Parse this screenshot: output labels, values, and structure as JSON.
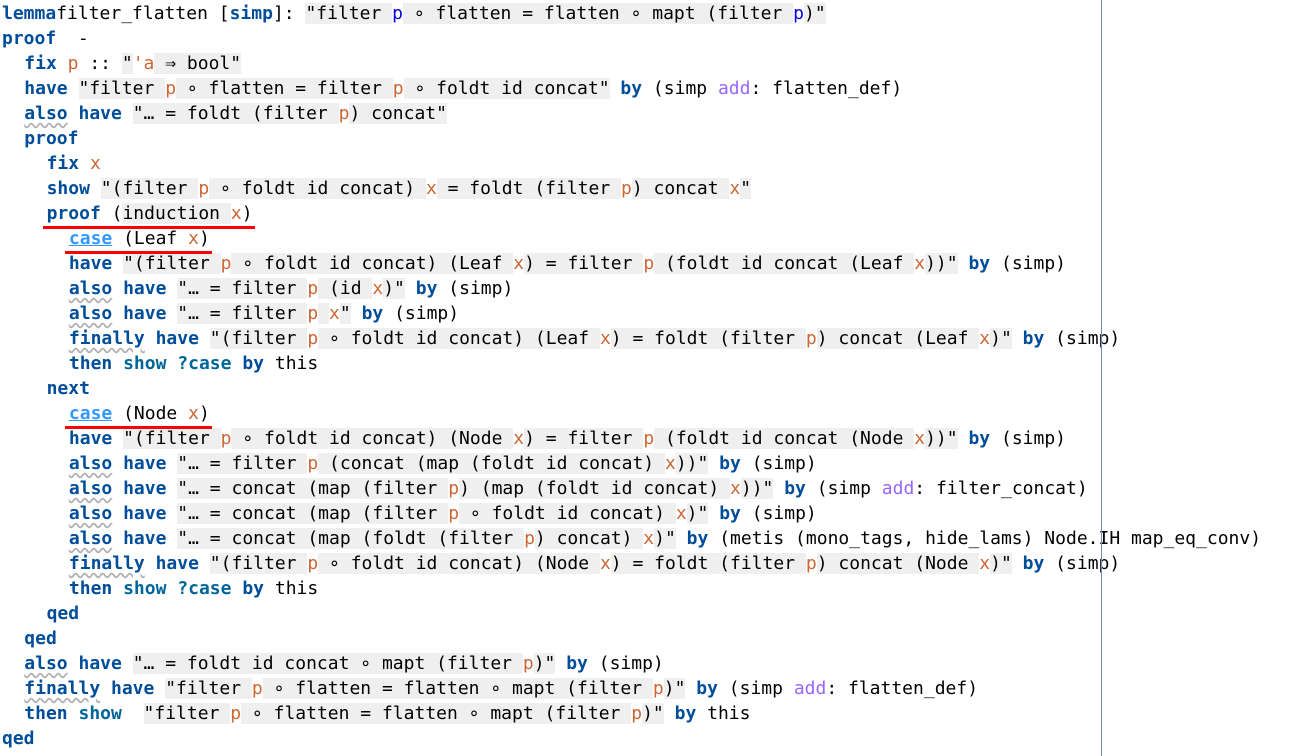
{
  "editor": {
    "lines": [
      {
        "indent": 0,
        "tokens": [
          [
            "kw",
            "lemma"
          ],
          [
            "",
            "filter_flatten ["
          ],
          [
            "kw",
            "simp"
          ],
          [
            "",
            "]: "
          ],
          [
            "str",
            "\"filter "
          ],
          [
            "fb",
            "p"
          ],
          [
            "str",
            " ∘ flatten = flatten ∘ mapt (filter "
          ],
          [
            "fb",
            "p"
          ],
          [
            "str",
            ")\""
          ]
        ]
      },
      {
        "indent": 0,
        "tokens": [
          [
            "kw",
            "proof"
          ],
          [
            "",
            "  -"
          ]
        ]
      },
      {
        "indent": 1,
        "tokens": [
          [
            "kw",
            "fix"
          ],
          [
            "",
            " "
          ],
          [
            "fv",
            "p"
          ],
          [
            "",
            " :: "
          ],
          [
            "str",
            "\""
          ],
          [
            "tv",
            "'a"
          ],
          [
            "str",
            " ⇒ bool\""
          ]
        ]
      },
      {
        "indent": 1,
        "tokens": [
          [
            "kw",
            "have"
          ],
          [
            "",
            " "
          ],
          [
            "str",
            "\"filter "
          ],
          [
            "fv",
            "p"
          ],
          [
            "str",
            " ∘ flatten = filter "
          ],
          [
            "fv",
            "p"
          ],
          [
            "str",
            " ∘ foldt id concat\""
          ],
          [
            "",
            " "
          ],
          [
            "kw",
            "by"
          ],
          [
            "",
            " ("
          ],
          [
            "",
            "simp "
          ],
          [
            "add",
            "add"
          ],
          [
            "",
            ": flatten_def)"
          ]
        ]
      },
      {
        "indent": 1,
        "tokens": [
          [
            "kw sq",
            "also"
          ],
          [
            "",
            " "
          ],
          [
            "kw",
            "have"
          ],
          [
            "",
            " "
          ],
          [
            "str",
            "\"… = foldt (filter "
          ],
          [
            "fv",
            "p"
          ],
          [
            "str",
            ") concat\""
          ]
        ]
      },
      {
        "indent": 1,
        "tokens": [
          [
            "kw",
            "proof"
          ]
        ]
      },
      {
        "indent": 2,
        "tokens": [
          [
            "kw",
            "fix"
          ],
          [
            "",
            " "
          ],
          [
            "fv",
            "x"
          ]
        ]
      },
      {
        "indent": 2,
        "tokens": [
          [
            "kw",
            "show"
          ],
          [
            "",
            " "
          ],
          [
            "str",
            "\"(filter "
          ],
          [
            "fv",
            "p"
          ],
          [
            "str",
            " ∘ foldt id concat) "
          ],
          [
            "fv",
            "x"
          ],
          [
            "str",
            " = foldt (filter "
          ],
          [
            "fv",
            "p"
          ],
          [
            "str",
            ") concat "
          ],
          [
            "fv",
            "x"
          ],
          [
            "str",
            "\""
          ]
        ]
      },
      {
        "indent": 2,
        "tokens": [
          [
            "kw",
            "proof"
          ],
          [
            "",
            " ("
          ],
          [
            "str",
            "induction "
          ],
          [
            "fv",
            "x"
          ],
          [
            "",
            ")"
          ]
        ]
      },
      {
        "indent": 3,
        "tokens": [
          [
            "case",
            "case"
          ],
          [
            "",
            " (Leaf "
          ],
          [
            "fv",
            "x"
          ],
          [
            "",
            ")"
          ]
        ]
      },
      {
        "indent": 3,
        "tokens": [
          [
            "kw",
            "have"
          ],
          [
            "",
            " "
          ],
          [
            "str",
            "\"(filter "
          ],
          [
            "fv",
            "p"
          ],
          [
            "str",
            " ∘ foldt id concat) (Leaf "
          ],
          [
            "fv",
            "x"
          ],
          [
            "str",
            ") = filter "
          ],
          [
            "fv",
            "p"
          ],
          [
            "str",
            " (foldt id concat (Leaf "
          ],
          [
            "fv",
            "x"
          ],
          [
            "str",
            "))\""
          ],
          [
            "",
            " "
          ],
          [
            "kw",
            "by"
          ],
          [
            "",
            " (simp)"
          ]
        ]
      },
      {
        "indent": 3,
        "tokens": [
          [
            "kw sq",
            "also"
          ],
          [
            "",
            " "
          ],
          [
            "kw",
            "have"
          ],
          [
            "",
            " "
          ],
          [
            "str",
            "\"… = filter "
          ],
          [
            "fv",
            "p"
          ],
          [
            "str",
            " (id "
          ],
          [
            "fv",
            "x"
          ],
          [
            "str",
            ")\""
          ],
          [
            "",
            " "
          ],
          [
            "kw",
            "by"
          ],
          [
            "",
            " (simp)"
          ]
        ]
      },
      {
        "indent": 3,
        "tokens": [
          [
            "kw sq",
            "also"
          ],
          [
            "",
            " "
          ],
          [
            "kw",
            "have"
          ],
          [
            "",
            " "
          ],
          [
            "str",
            "\"… = filter "
          ],
          [
            "fv",
            "p"
          ],
          [
            "str",
            " "
          ],
          [
            "fv",
            "x"
          ],
          [
            "str",
            "\""
          ],
          [
            "",
            " "
          ],
          [
            "kw",
            "by"
          ],
          [
            "",
            " (simp)"
          ]
        ]
      },
      {
        "indent": 3,
        "tokens": [
          [
            "kw sq",
            "finally"
          ],
          [
            "",
            " "
          ],
          [
            "kw",
            "have"
          ],
          [
            "",
            " "
          ],
          [
            "str",
            "\"(filter "
          ],
          [
            "fv",
            "p"
          ],
          [
            "str",
            " ∘ foldt id concat) (Leaf "
          ],
          [
            "fv",
            "x"
          ],
          [
            "str",
            ") = foldt (filter "
          ],
          [
            "fv",
            "p"
          ],
          [
            "str",
            ") concat (Leaf "
          ],
          [
            "fv",
            "x"
          ],
          [
            "str",
            ")\""
          ],
          [
            "",
            " "
          ],
          [
            "kw",
            "by"
          ],
          [
            "",
            " (simp)"
          ]
        ]
      },
      {
        "indent": 3,
        "tokens": [
          [
            "kw",
            "then"
          ],
          [
            "",
            " "
          ],
          [
            "kwq",
            "show"
          ],
          [
            "",
            " "
          ],
          [
            "kwq",
            "?case"
          ],
          [
            "",
            " "
          ],
          [
            "kw",
            "by"
          ],
          [
            "",
            " this"
          ]
        ]
      },
      {
        "indent": 2,
        "tokens": [
          [
            "kw",
            "next"
          ]
        ]
      },
      {
        "indent": 3,
        "tokens": [
          [
            "case",
            "case"
          ],
          [
            "",
            " (Node "
          ],
          [
            "fv",
            "x"
          ],
          [
            "",
            ")"
          ]
        ]
      },
      {
        "indent": 3,
        "tokens": [
          [
            "kw",
            "have"
          ],
          [
            "",
            " "
          ],
          [
            "str",
            "\"(filter "
          ],
          [
            "fv",
            "p"
          ],
          [
            "str",
            " ∘ foldt id concat) (Node "
          ],
          [
            "fv",
            "x"
          ],
          [
            "str",
            ") = filter "
          ],
          [
            "fv",
            "p"
          ],
          [
            "str",
            " (foldt id concat (Node "
          ],
          [
            "fv",
            "x"
          ],
          [
            "str",
            "))\""
          ],
          [
            "",
            " "
          ],
          [
            "kw",
            "by"
          ],
          [
            "",
            " (simp)"
          ]
        ]
      },
      {
        "indent": 3,
        "tokens": [
          [
            "kw sq",
            "also"
          ],
          [
            "",
            " "
          ],
          [
            "kw",
            "have"
          ],
          [
            "",
            " "
          ],
          [
            "str",
            "\"… = filter "
          ],
          [
            "fv",
            "p"
          ],
          [
            "str",
            " (concat (map (foldt id concat) "
          ],
          [
            "fv",
            "x"
          ],
          [
            "str",
            "))\""
          ],
          [
            "",
            " "
          ],
          [
            "kw",
            "by"
          ],
          [
            "",
            " (simp)"
          ]
        ]
      },
      {
        "indent": 3,
        "tokens": [
          [
            "kw sq",
            "also"
          ],
          [
            "",
            " "
          ],
          [
            "kw",
            "have"
          ],
          [
            "",
            " "
          ],
          [
            "str",
            "\"… = concat (map (filter "
          ],
          [
            "fv",
            "p"
          ],
          [
            "str",
            ") (map (foldt id concat) "
          ],
          [
            "fv",
            "x"
          ],
          [
            "str",
            "))\""
          ],
          [
            "",
            " "
          ],
          [
            "kw",
            "by"
          ],
          [
            "",
            " (simp "
          ],
          [
            "add",
            "add"
          ],
          [
            "",
            ": filter_concat)"
          ]
        ]
      },
      {
        "indent": 3,
        "tokens": [
          [
            "kw sq",
            "also"
          ],
          [
            "",
            " "
          ],
          [
            "kw",
            "have"
          ],
          [
            "",
            " "
          ],
          [
            "str",
            "\"… = concat (map (filter "
          ],
          [
            "fv",
            "p"
          ],
          [
            "str",
            " ∘ foldt id concat) "
          ],
          [
            "fv",
            "x"
          ],
          [
            "str",
            ")\""
          ],
          [
            "",
            " "
          ],
          [
            "kw",
            "by"
          ],
          [
            "",
            " (simp)"
          ]
        ]
      },
      {
        "indent": 3,
        "tokens": [
          [
            "kw sq",
            "also"
          ],
          [
            "",
            " "
          ],
          [
            "kw",
            "have"
          ],
          [
            "",
            " "
          ],
          [
            "str",
            "\"… = concat (map (foldt (filter "
          ],
          [
            "fv",
            "p"
          ],
          [
            "str",
            ") concat) "
          ],
          [
            "fv",
            "x"
          ],
          [
            "str",
            ")\""
          ],
          [
            "",
            " "
          ],
          [
            "kw",
            "by"
          ],
          [
            "",
            " (metis (mono_tags, hide_lams) Node.IH map_eq_conv)"
          ]
        ]
      },
      {
        "indent": 3,
        "tokens": [
          [
            "kw sq",
            "finally"
          ],
          [
            "",
            " "
          ],
          [
            "kw",
            "have"
          ],
          [
            "",
            " "
          ],
          [
            "str",
            "\"(filter "
          ],
          [
            "fv",
            "p"
          ],
          [
            "str",
            " ∘ foldt id concat) (Node "
          ],
          [
            "fv",
            "x"
          ],
          [
            "str",
            ") = foldt (filter "
          ],
          [
            "fv",
            "p"
          ],
          [
            "str",
            ") concat (Node "
          ],
          [
            "fv",
            "x"
          ],
          [
            "str",
            ")\""
          ],
          [
            "",
            " "
          ],
          [
            "kw",
            "by"
          ],
          [
            "",
            " (simp)"
          ]
        ]
      },
      {
        "indent": 3,
        "tokens": [
          [
            "kw",
            "then"
          ],
          [
            "",
            " "
          ],
          [
            "kwq",
            "show"
          ],
          [
            "",
            " "
          ],
          [
            "kwq",
            "?case"
          ],
          [
            "",
            " "
          ],
          [
            "kw",
            "by"
          ],
          [
            "",
            " this"
          ]
        ]
      },
      {
        "indent": 2,
        "tokens": [
          [
            "kw",
            "qed"
          ]
        ]
      },
      {
        "indent": 1,
        "tokens": [
          [
            "kw",
            "qed"
          ]
        ]
      },
      {
        "indent": 1,
        "tokens": [
          [
            "kw sq",
            "also"
          ],
          [
            "",
            " "
          ],
          [
            "kw",
            "have"
          ],
          [
            "",
            " "
          ],
          [
            "str",
            "\"… = foldt id concat ∘ mapt (filter "
          ],
          [
            "fv",
            "p"
          ],
          [
            "str",
            ")\""
          ],
          [
            "",
            " "
          ],
          [
            "kw",
            "by"
          ],
          [
            "",
            " (simp)"
          ]
        ]
      },
      {
        "indent": 1,
        "tokens": [
          [
            "kw sq",
            "finally"
          ],
          [
            "",
            " "
          ],
          [
            "kw",
            "have"
          ],
          [
            "",
            " "
          ],
          [
            "str",
            "\"filter "
          ],
          [
            "fv",
            "p"
          ],
          [
            "str",
            " ∘ flatten = flatten ∘ mapt (filter "
          ],
          [
            "fv",
            "p"
          ],
          [
            "str",
            ")\""
          ],
          [
            "",
            " "
          ],
          [
            "kw",
            "by"
          ],
          [
            "",
            " (simp "
          ],
          [
            "add",
            "add"
          ],
          [
            "",
            ": flatten_def)"
          ]
        ]
      },
      {
        "indent": 1,
        "tokens": [
          [
            "kw",
            "then"
          ],
          [
            "",
            " "
          ],
          [
            "kwq",
            "show"
          ],
          [
            "",
            "  "
          ],
          [
            "str",
            "\"filter "
          ],
          [
            "fv",
            "p"
          ],
          [
            "str",
            " ∘ flatten = flatten ∘ mapt (filter "
          ],
          [
            "fv",
            "p"
          ],
          [
            "str",
            ")\""
          ],
          [
            "",
            " "
          ],
          [
            "kw",
            "by"
          ],
          [
            "",
            " this"
          ]
        ]
      },
      {
        "indent": 0,
        "tokens": [
          [
            "kw",
            "qed"
          ]
        ]
      }
    ]
  }
}
